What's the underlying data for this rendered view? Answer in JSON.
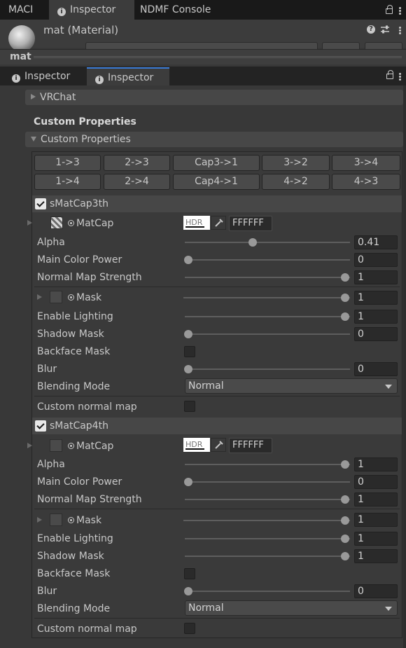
{
  "top_tabs": [
    {
      "label": "MACI"
    },
    {
      "label": "Inspector"
    },
    {
      "label": "NDMF Console"
    }
  ],
  "material_header": {
    "name": "mat (Material)",
    "help_icon": "help-icon",
    "settings_icon": "sliders-icon",
    "menu_icon": "kebab-menu-icon"
  },
  "object_bar": {
    "title": "mat"
  },
  "second_tabs": [
    {
      "label": "Inspector"
    },
    {
      "label": "Inspector"
    }
  ],
  "sections": {
    "vrchat": "VRChat",
    "custom_title": "Custom Properties",
    "custom_foldout": "Custom Properties"
  },
  "copy_buttons": [
    [
      "1->3",
      "2->3",
      "Cap3->1",
      "3->2",
      "3->4"
    ],
    [
      "1->4",
      "2->4",
      "Cap4->1",
      "4->2",
      "4->3"
    ]
  ],
  "matcap3": {
    "header": "sMatCap3th",
    "enabled": true,
    "matcap_label": "MatCap",
    "hdr_label": "HDR",
    "hex": "FFFFFF",
    "alpha_label": "Alpha",
    "alpha": "0.41",
    "main_color_power_label": "Main Color Power",
    "main_color_power": "0",
    "normal_map_strength_label": "Normal Map Strength",
    "normal_map_strength": "1",
    "mask_label": "Mask",
    "mask": "1",
    "enable_lighting_label": "Enable Lighting",
    "enable_lighting": "1",
    "shadow_mask_label": "Shadow Mask",
    "shadow_mask": "0",
    "backface_mask_label": "Backface Mask",
    "blur_label": "Blur",
    "blur": "0",
    "blending_mode_label": "Blending Mode",
    "blending_mode": "Normal",
    "custom_normal_map_label": "Custom normal map"
  },
  "matcap4": {
    "header": "sMatCap4th",
    "enabled": true,
    "matcap_label": "MatCap",
    "hdr_label": "HDR",
    "hex": "FFFFFF",
    "alpha_label": "Alpha",
    "alpha": "1",
    "main_color_power_label": "Main Color Power",
    "main_color_power": "0",
    "normal_map_strength_label": "Normal Map Strength",
    "normal_map_strength": "1",
    "mask_label": "Mask",
    "mask": "1",
    "enable_lighting_label": "Enable Lighting",
    "enable_lighting": "1",
    "shadow_mask_label": "Shadow Mask",
    "shadow_mask": "1",
    "backface_mask_label": "Backface Mask",
    "blur_label": "Blur",
    "blur": "0",
    "blending_mode_label": "Blending Mode",
    "blending_mode": "Normal",
    "custom_normal_map_label": "Custom normal map"
  },
  "colors": {
    "accent_tab": "#3a7bd5",
    "panel": "#383838",
    "tabbar": "#191919"
  }
}
